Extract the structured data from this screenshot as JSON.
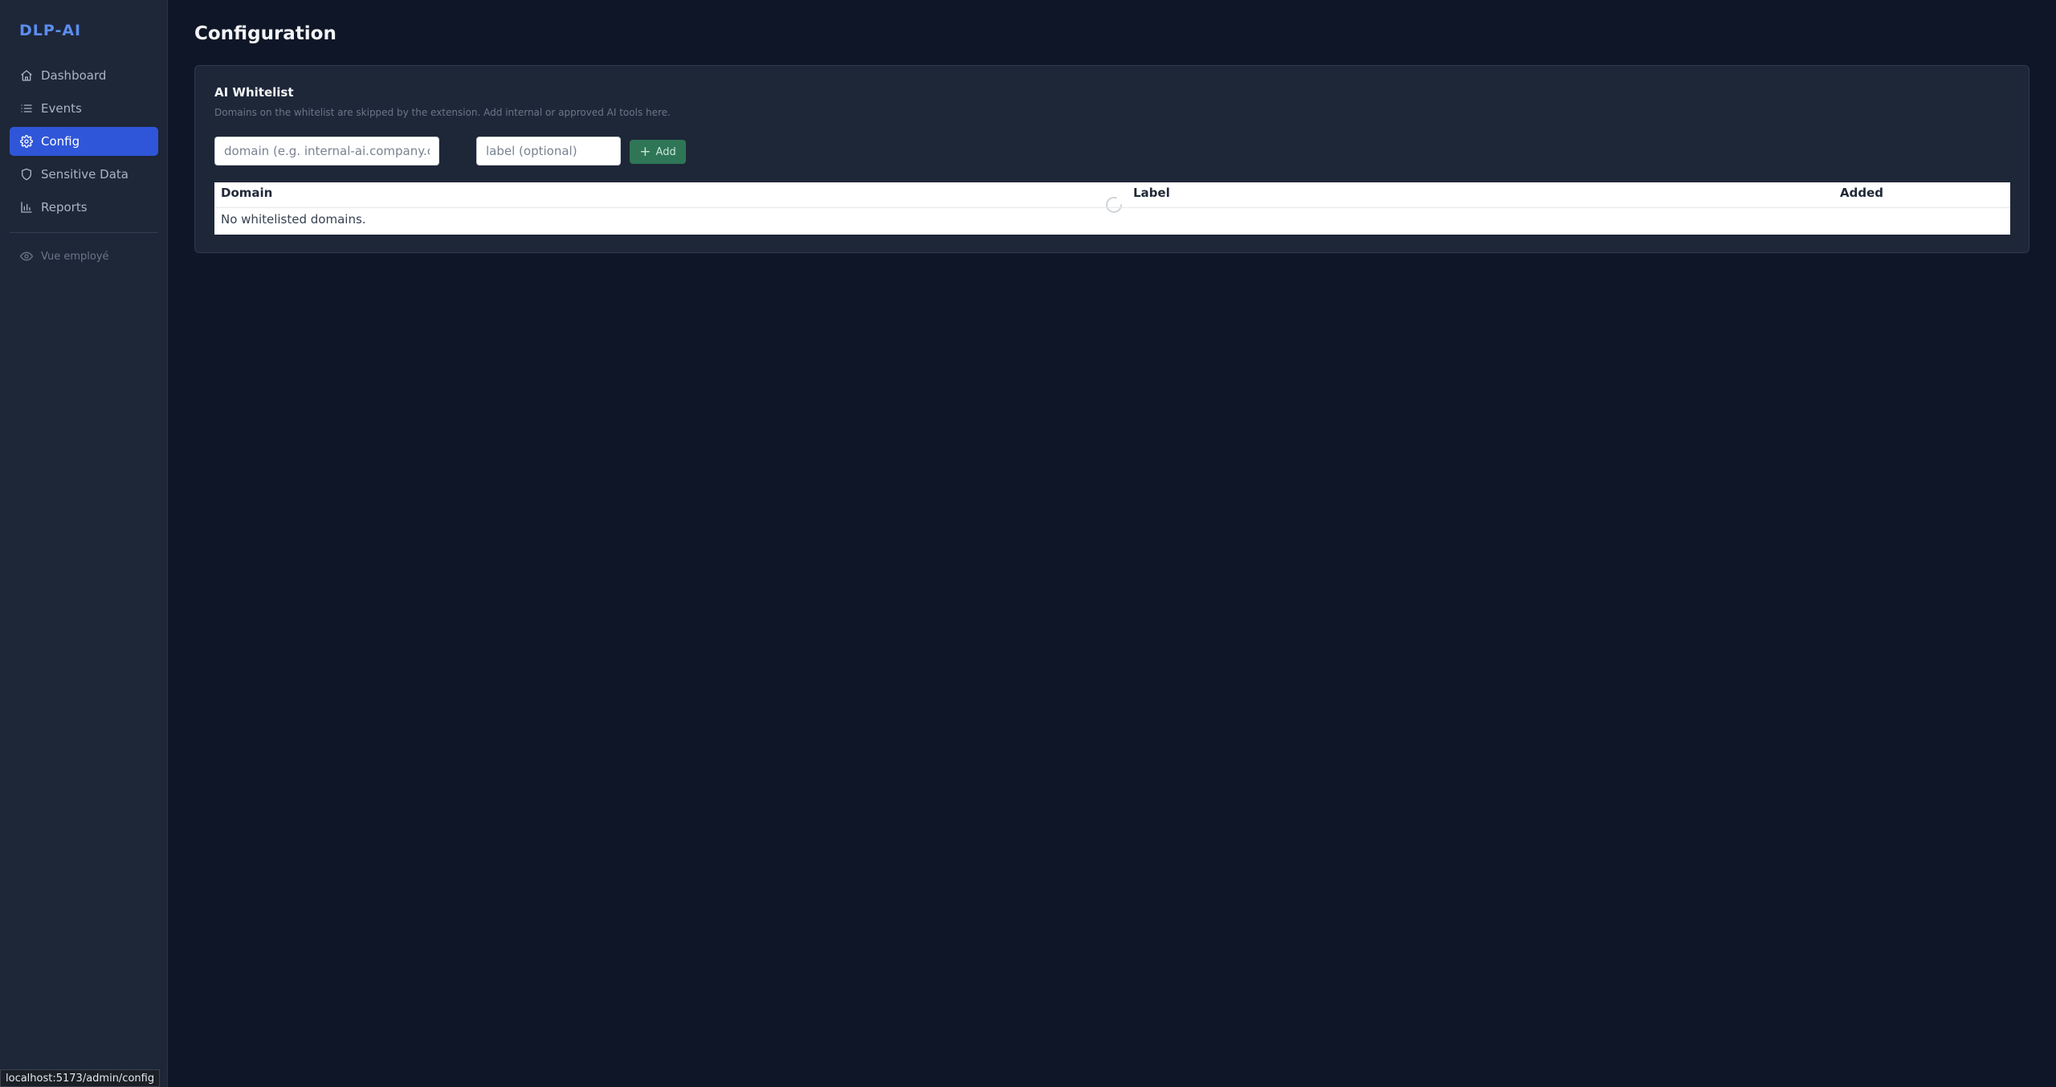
{
  "app": {
    "brand": "DLP-AI"
  },
  "sidebar": {
    "items": [
      {
        "label": "Dashboard",
        "icon": "home-icon"
      },
      {
        "label": "Events",
        "icon": "list-icon"
      },
      {
        "label": "Config",
        "icon": "gear-icon",
        "active": true
      },
      {
        "label": "Sensitive Data",
        "icon": "shield-icon"
      },
      {
        "label": "Reports",
        "icon": "bar-chart-icon"
      }
    ],
    "footer_item": {
      "label": "Vue employé",
      "icon": "eye-icon"
    }
  },
  "page": {
    "title": "Configuration"
  },
  "whitelist": {
    "title": "AI Whitelist",
    "description": "Domains on the whitelist are skipped by the extension. Add internal or approved AI tools here.",
    "domain_placeholder": "domain (e.g. internal-ai.company.com)",
    "label_placeholder": "label (optional)",
    "add_label": "Add",
    "columns": [
      "Domain",
      "Label",
      "Added"
    ],
    "empty_message": "No whitelisted domains."
  },
  "status_bar": {
    "url": "localhost:5173/admin/config"
  },
  "colors": {
    "accent": "#2f56d8",
    "brand": "#5b8def",
    "add_button": "#2f7656",
    "background": "#0f1627",
    "panel": "#1e2738"
  }
}
